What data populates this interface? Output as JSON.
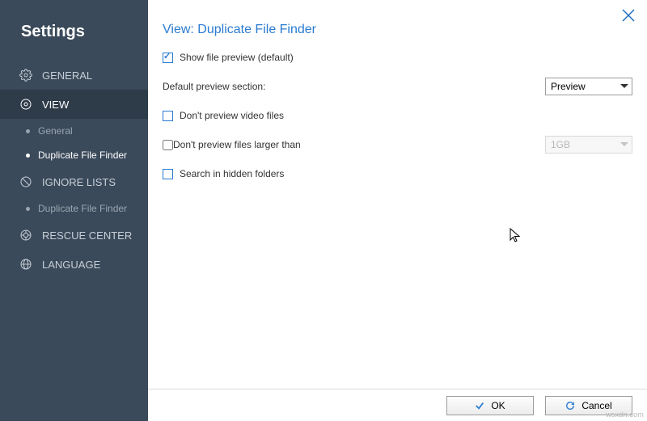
{
  "sidebar": {
    "title": "Settings",
    "items": [
      {
        "label": "GENERAL",
        "active": false
      },
      {
        "label": "VIEW",
        "active": true
      },
      {
        "label": "IGNORE LISTS",
        "active": false
      },
      {
        "label": "RESCUE CENTER",
        "active": false
      },
      {
        "label": "LANGUAGE",
        "active": false
      }
    ],
    "view_subitems": [
      {
        "label": "General",
        "active": false
      },
      {
        "label": "Duplicate File Finder",
        "active": true
      }
    ],
    "ignore_subitems": [
      {
        "label": "Duplicate File Finder",
        "active": false
      }
    ]
  },
  "main": {
    "title": "View: Duplicate File Finder",
    "show_preview": {
      "label": "Show file preview (default)",
      "checked": true
    },
    "default_section": {
      "label": "Default preview section:",
      "value": "Preview"
    },
    "no_video": {
      "label": "Don't preview video files",
      "checked": false
    },
    "no_large": {
      "label": "Don't preview files larger than",
      "checked": false,
      "value": "1GB"
    },
    "hidden": {
      "label": "Search in hidden folders",
      "checked": false
    }
  },
  "footer": {
    "ok": "OK",
    "cancel": "Cancel"
  },
  "watermark": "wsxdn.com"
}
